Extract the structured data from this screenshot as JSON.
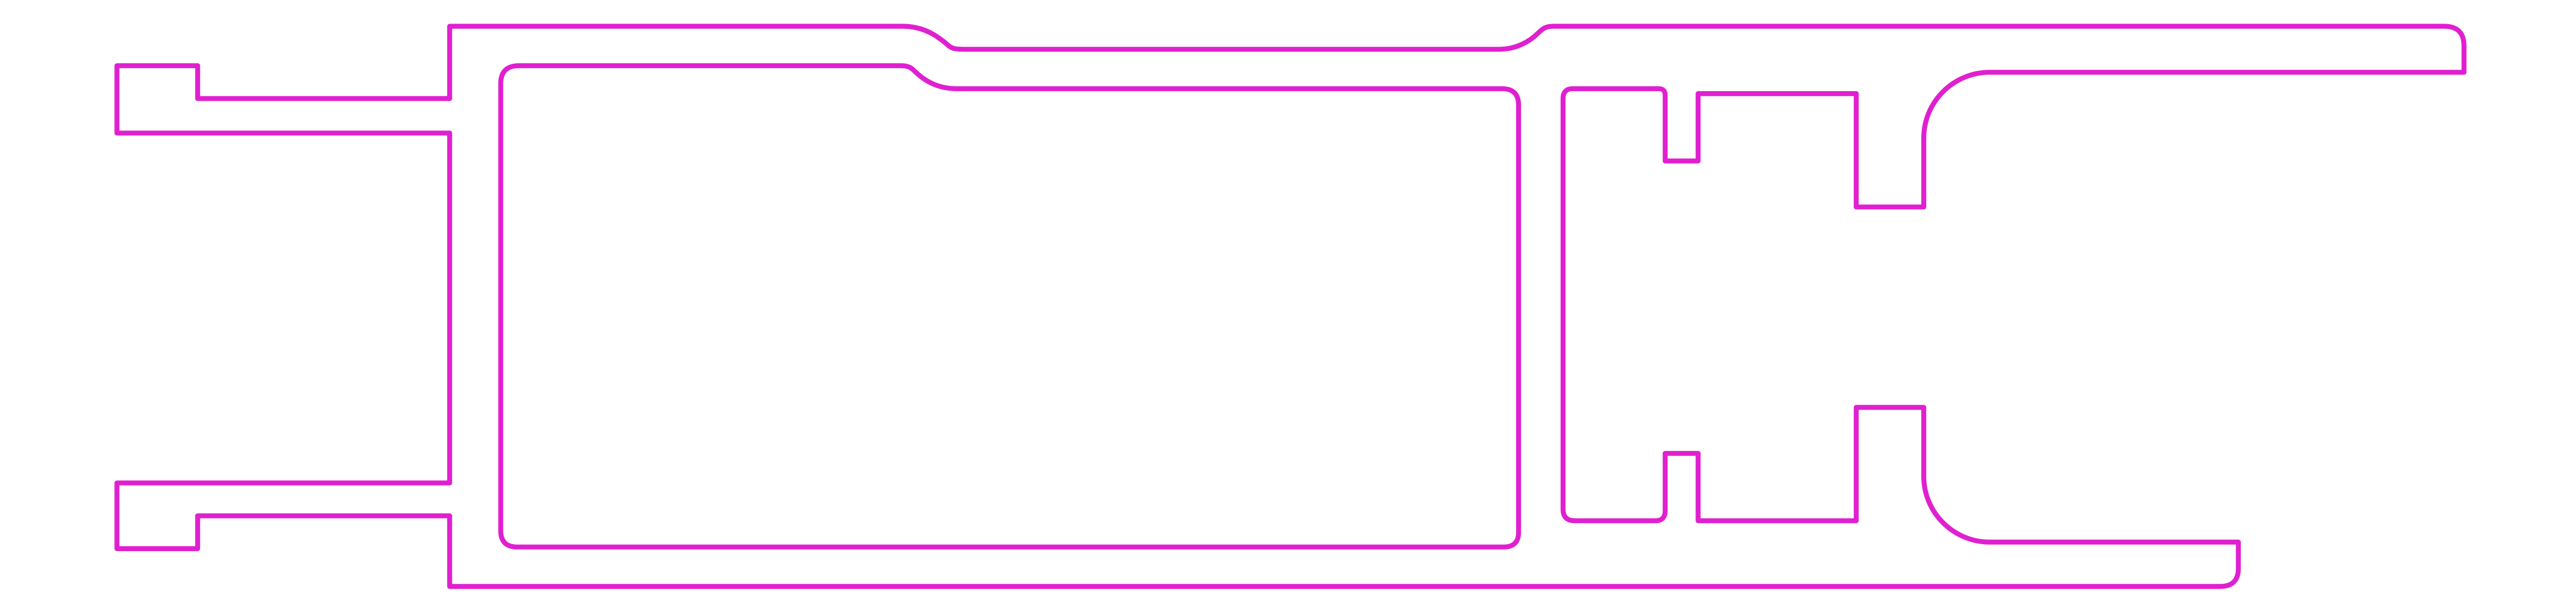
{
  "drawing": {
    "background": "#ffffff",
    "stroke_color": "#e020d0",
    "shapes": [
      "outer-profile",
      "main-cavity",
      "right-slot-cavity"
    ]
  }
}
